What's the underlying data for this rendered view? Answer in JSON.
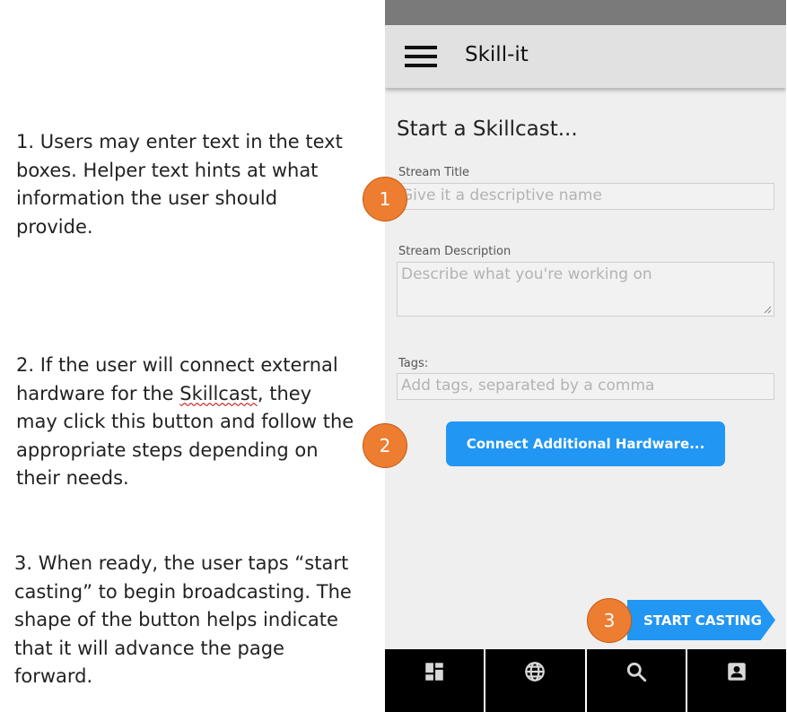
{
  "annotations": {
    "note_1": "1. Users may enter text in the text boxes. Helper text hints at what information the user should provide.",
    "note_2_before": "2. If the user will connect external hardware for the ",
    "note_2_word": "Skillcast",
    "note_2_after": ", they may click this button and follow the appropriate steps depending on their needs.",
    "note_3": "3. When ready, the user taps “start casting” to begin broadcasting. The shape of the button helps indicate that it will advance the page forward.",
    "callouts": [
      "1",
      "2",
      "3"
    ]
  },
  "app_bar": {
    "title": "Skill-it",
    "menu_icon": "hamburger-menu-icon"
  },
  "form": {
    "page_title": "Start a Skillcast...",
    "stream_title": {
      "label": "Stream Title",
      "placeholder": "Give it a descriptive name",
      "value": ""
    },
    "stream_description": {
      "label": "Stream Description",
      "placeholder": "Describe what you're working on",
      "value": ""
    },
    "tags": {
      "label": "Tags:",
      "placeholder": "Add tags, separated by a comma",
      "value": ""
    },
    "hardware_button_label": "Connect Additional Hardware...",
    "start_casting_label": "START CASTING"
  },
  "bottom_nav": {
    "items": [
      {
        "icon": "dashboard-icon"
      },
      {
        "icon": "globe-icon"
      },
      {
        "icon": "search-icon"
      },
      {
        "icon": "profile-icon"
      }
    ]
  },
  "colors": {
    "accent": "#2196f3",
    "callout": "#ed7d31",
    "app_bar": "#e1e1e1",
    "status_bar": "#7a7a7a",
    "nav_bar": "#000000"
  }
}
